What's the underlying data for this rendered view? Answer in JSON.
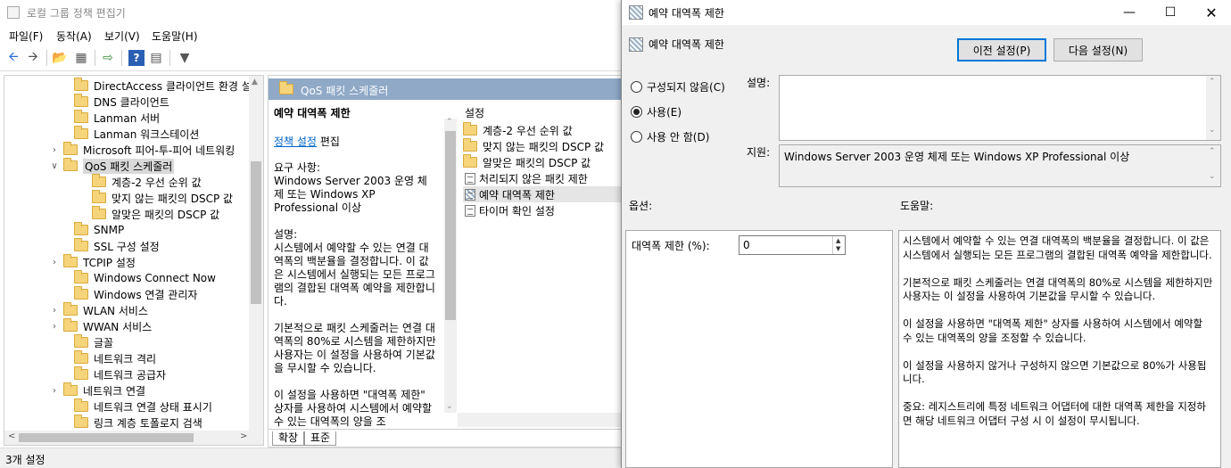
{
  "gpe": {
    "title": "로컬 그룹 정책 편집기",
    "menu": [
      "파일(F)",
      "동작(A)",
      "보기(V)",
      "도움말(H)"
    ],
    "tree": [
      {
        "label": "DirectAccess 클라이언트 환경 설",
        "expander": ""
      },
      {
        "label": "DNS 클라이언트",
        "expander": ""
      },
      {
        "label": "Lanman 서버",
        "expander": ""
      },
      {
        "label": "Lanman 워크스테이션",
        "expander": ""
      },
      {
        "label": "Microsoft 피어-투-피어 네트워킹",
        "expander": ">"
      },
      {
        "label": "QoS 패킷 스케줄러",
        "expander": "v"
      },
      {
        "label": "계층-2 우선 순위 값",
        "expander": ""
      },
      {
        "label": "맞지 않는 패킷의 DSCP 값",
        "expander": ""
      },
      {
        "label": "알맞은 패킷의 DSCP 값",
        "expander": ""
      },
      {
        "label": "SNMP",
        "expander": ""
      },
      {
        "label": "SSL 구성 설정",
        "expander": ""
      },
      {
        "label": "TCPIP 설정",
        "expander": ">"
      },
      {
        "label": "Windows Connect Now",
        "expander": ""
      },
      {
        "label": "Windows 연결 관리자",
        "expander": ""
      },
      {
        "label": "WLAN 서비스",
        "expander": ">"
      },
      {
        "label": "WWAN 서비스",
        "expander": ">"
      },
      {
        "label": "글꼴",
        "expander": ""
      },
      {
        "label": "네트워크 격리",
        "expander": ""
      },
      {
        "label": "네트워크 공급자",
        "expander": ""
      },
      {
        "label": "네트워크 연결",
        "expander": ">"
      },
      {
        "label": "네트워크 연결 상태 표시기",
        "expander": ""
      },
      {
        "label": "링크 계층 토폴로지 검색",
        "expander": ""
      }
    ],
    "pane_title": "QoS 패킷 스케줄러",
    "desc": {
      "title": "예약 대역폭 제한",
      "policy_link": "정책 설정",
      "edit": "편집",
      "body": "요구 사항:\nWindows Server 2003 운영 체제 또는 Windows XP Professional 이상\n\n설명:\n시스템에서 예약할 수 있는 연결 대역폭의 백분율을 결정합니다. 이 값은 시스템에서 실행되는 모든 프로그램의 결합된 대역폭 예약을 제한합니다.\n\n기본적으로 패킷 스케줄러는 연결 대역폭의 80%로 시스템을 제한하지만 사용자는 이 설정을 사용하여 기본값을 무시할 수 있습니다.\n\n이 설정을 사용하면 \"대역폭 제한\" 상자를 사용하여 시스템에서 예약할 수 있는 대역폭의 양을 조"
    },
    "list_header": "설정",
    "list": [
      {
        "label": "계층-2 우선 순위 값",
        "type": "folder"
      },
      {
        "label": "맞지 않는 패킷의 DSCP 값",
        "type": "folder"
      },
      {
        "label": "알맞은 패킷의 DSCP 값",
        "type": "folder"
      },
      {
        "label": "처리되지 않은 패킷 제한",
        "type": "policy"
      },
      {
        "label": "예약 대역폭 제한",
        "type": "policy-selected"
      },
      {
        "label": "타이머 확인 설정",
        "type": "policy"
      }
    ],
    "tabs": [
      "확장",
      "표준"
    ],
    "status": "3개 설정"
  },
  "dialog": {
    "title": "예약 대역폭 제한",
    "header": "예약 대역폭 제한",
    "prev_button": "이전 설정(P)",
    "next_button": "다음 설정(N)",
    "radios": [
      {
        "label": "구성되지 않음(C)",
        "checked": false
      },
      {
        "label": "사용(E)",
        "checked": true
      },
      {
        "label": "사용 안 함(D)",
        "checked": false
      }
    ],
    "comment_label": "설명:",
    "comment_value": "",
    "supported_label": "지원:",
    "supported_value": "Windows Server 2003 운영 체제 또는 Windows XP Professional 이상",
    "options_label": "옵션:",
    "help_label": "도움말:",
    "bandwidth_label": "대역폭 제한 (%):",
    "bandwidth_value": "0",
    "help_text": "시스템에서 예약할 수 있는 연결 대역폭의 백분율을 결정합니다. 이 값은 시스템에서 실행되는 모든 프로그램의 결합된 대역폭 예약을 제한합니다.\n\n기본적으로 패킷 스케줄러는 연결 대역폭의 80%로 시스템을 제한하지만 사용자는 이 설정을 사용하여 기본값을 무시할 수 있습니다.\n\n이 설정을 사용하면 \"대역폭 제한\" 상자를 사용하여 시스템에서 예약할 수 있는 대역폭의 양을 조정할 수 있습니다.\n\n이 설정을 사용하지 않거나 구성하지 않으면 기본값으로 80%가 사용됩니다.\n\n중요: 레지스트리에 특정 네트워크 어댑터에 대한 대역폭 제한을 지정하면 해당 네트워크 어댑터 구성 시 이 설정이 무시됩니다."
  }
}
